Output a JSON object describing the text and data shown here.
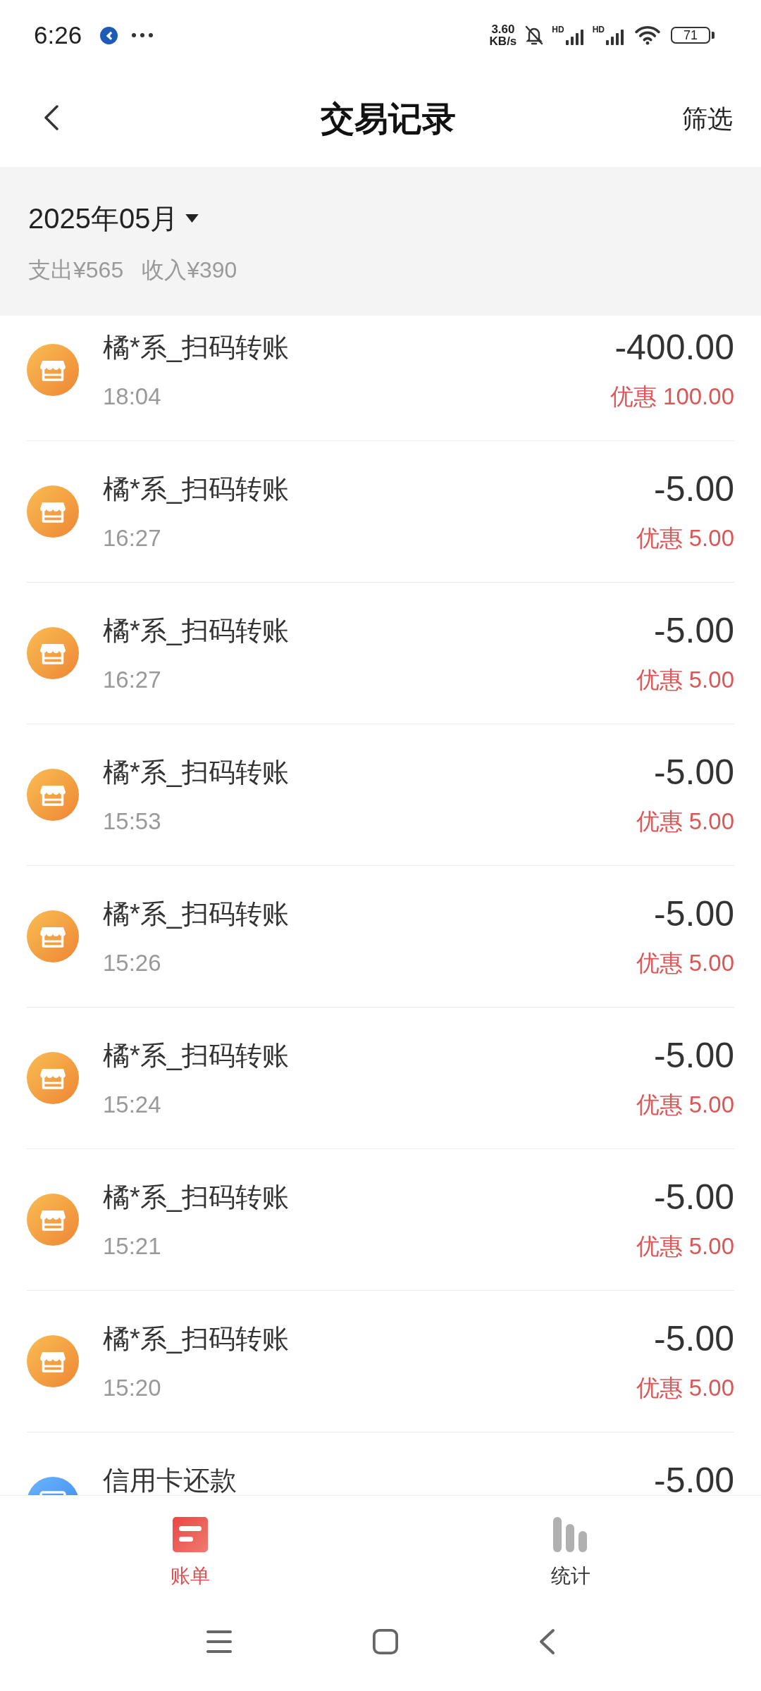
{
  "status_bar": {
    "time": "6:26",
    "net_speed": "3.60",
    "net_unit": "KB/s",
    "signals": [
      {
        "label": "HD"
      },
      {
        "label": "HD"
      }
    ],
    "battery": "71"
  },
  "header": {
    "title": "交易记录",
    "action": "筛选"
  },
  "summary": {
    "month": "2025年05月",
    "expense": "支出¥565",
    "income": "收入¥390"
  },
  "transactions": [
    {
      "kind": "store",
      "name": "橘*系_扫码转账",
      "time": "18:04",
      "amount": "-400.00",
      "discount": "优惠 100.00"
    },
    {
      "kind": "store",
      "name": "橘*系_扫码转账",
      "time": "16:27",
      "amount": "-5.00",
      "discount": "优惠 5.00"
    },
    {
      "kind": "store",
      "name": "橘*系_扫码转账",
      "time": "16:27",
      "amount": "-5.00",
      "discount": "优惠 5.00"
    },
    {
      "kind": "store",
      "name": "橘*系_扫码转账",
      "time": "15:53",
      "amount": "-5.00",
      "discount": "优惠 5.00"
    },
    {
      "kind": "store",
      "name": "橘*系_扫码转账",
      "time": "15:26",
      "amount": "-5.00",
      "discount": "优惠 5.00"
    },
    {
      "kind": "store",
      "name": "橘*系_扫码转账",
      "time": "15:24",
      "amount": "-5.00",
      "discount": "优惠 5.00"
    },
    {
      "kind": "store",
      "name": "橘*系_扫码转账",
      "time": "15:21",
      "amount": "-5.00",
      "discount": "优惠 5.00"
    },
    {
      "kind": "store",
      "name": "橘*系_扫码转账",
      "time": "15:20",
      "amount": "-5.00",
      "discount": "优惠 5.00"
    },
    {
      "kind": "card",
      "name": "信用卡还款",
      "amount": "-5.00"
    }
  ],
  "tabs": [
    {
      "kind": "bill",
      "label": "账单",
      "selected": true
    },
    {
      "kind": "stats",
      "label": "统计",
      "selected": false
    }
  ]
}
